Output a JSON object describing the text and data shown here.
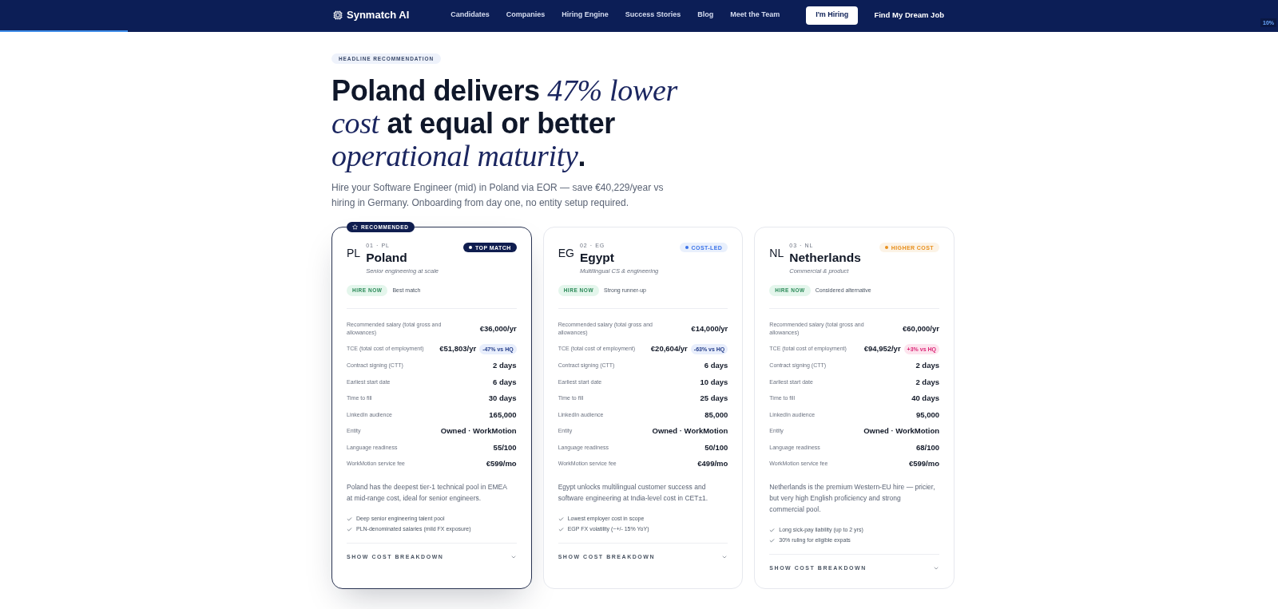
{
  "nav": {
    "brand": "Synmatch AI",
    "links": [
      "Candidates",
      "Companies",
      "Hiring Engine",
      "Success Stories",
      "Blog",
      "Meet the Team"
    ],
    "actions": [
      {
        "label": "I'm Hiring",
        "kind": "filled"
      },
      {
        "label": "Find My Dream Job",
        "kind": "plain"
      }
    ]
  },
  "scroll_progress": {
    "level": 0.1,
    "reading": "10%"
  },
  "hero": {
    "eyebrow": "HEADLINE RECOMMENDATION",
    "headline": "Poland delivers *47% lower cost* at equal or better *operational maturity*.",
    "subtitle": "Hire your Software Engineer (mid) in Poland via EOR — save €40,229/year vs hiring in Germany. Onboarding from day one, no entity setup required."
  },
  "cards": [
    {
      "recommended": true,
      "badge": "RECOMMENDED",
      "code": "PL",
      "index": "01 · PL",
      "name": "Poland",
      "tagline": "Senior engineering at scale",
      "tag": {
        "label": "TOP MATCH",
        "kind": "solid",
        "color": "#ffffff"
      },
      "status": "HIRE NOW",
      "note": "Best match",
      "rows": [
        {
          "label": "Recommended salary (total gross and allowances)",
          "value": "€36,000/yr"
        },
        {
          "label": "TCE (total cost of employment)",
          "value": "€51,803/yr",
          "delta": {
            "label": "-47% vs HQ",
            "kind": "lower"
          }
        },
        {
          "label": "Contract signing (CTT)",
          "value": "2 days"
        },
        {
          "label": "Earliest start date",
          "value": "6 days"
        },
        {
          "label": "Time to fill",
          "value": "30 days"
        },
        {
          "label": "LinkedIn audience",
          "value": "165,000"
        },
        {
          "label": "Entity",
          "value": "Owned · WorkMotion"
        },
        {
          "label": "Language readiness",
          "value": "55/100"
        },
        {
          "label": "WorkMotion service fee",
          "value": "€599/mo"
        }
      ],
      "description": "Poland has the deepest tier-1 technical pool in EMEA at mid-range cost, ideal for senior engineers.",
      "pros": [
        "Deep senior engineering talent pool",
        "PLN-denominated salaries (mild FX exposure)"
      ],
      "footer": {
        "label": "SHOW COST BREAKDOWN",
        "expanded": false
      }
    },
    {
      "recommended": false,
      "code": "EG",
      "index": "02 · EG",
      "name": "Egypt",
      "tagline": "Multilingual CS & engineering",
      "tag": {
        "label": "COST-LED",
        "kind": "soft",
        "color": "#3a72e8"
      },
      "status": "HIRE NOW",
      "note": "Strong runner-up",
      "rows": [
        {
          "label": "Recommended salary (total gross and allowances)",
          "value": "€14,000/yr"
        },
        {
          "label": "TCE (total cost of employment)",
          "value": "€20,604/yr",
          "delta": {
            "label": "-63% vs HQ",
            "kind": "lower"
          }
        },
        {
          "label": "Contract signing (CTT)",
          "value": "6 days"
        },
        {
          "label": "Earliest start date",
          "value": "10 days"
        },
        {
          "label": "Time to fill",
          "value": "25 days"
        },
        {
          "label": "LinkedIn audience",
          "value": "85,000"
        },
        {
          "label": "Entity",
          "value": "Owned · WorkMotion"
        },
        {
          "label": "Language readiness",
          "value": "50/100"
        },
        {
          "label": "WorkMotion service fee",
          "value": "€499/mo"
        }
      ],
      "description": "Egypt unlocks multilingual customer success and software engineering at India-level cost in CET±1.",
      "pros": [
        "Lowest employer cost in scope",
        "EGP FX volatility (~+/- 15% YoY)"
      ],
      "footer": {
        "label": "SHOW COST BREAKDOWN",
        "expanded": false
      }
    },
    {
      "recommended": false,
      "code": "NL",
      "index": "03 · NL",
      "name": "Netherlands",
      "tagline": "Commercial & product",
      "tag": {
        "label": "HIGHER COST",
        "kind": "soft",
        "color": "#e8901e"
      },
      "status": "HIRE NOW",
      "note": "Considered alternative",
      "rows": [
        {
          "label": "Recommended salary (total gross and allowances)",
          "value": "€60,000/yr"
        },
        {
          "label": "TCE (total cost of employment)",
          "value": "€94,952/yr",
          "delta": {
            "label": "+3% vs HQ",
            "kind": "higher"
          }
        },
        {
          "label": "Contract signing (CTT)",
          "value": "2 days"
        },
        {
          "label": "Earliest start date",
          "value": "2 days"
        },
        {
          "label": "Time to fill",
          "value": "40 days"
        },
        {
          "label": "LinkedIn audience",
          "value": "95,000"
        },
        {
          "label": "Entity",
          "value": "Owned · WorkMotion"
        },
        {
          "label": "Language readiness",
          "value": "68/100"
        },
        {
          "label": "WorkMotion service fee",
          "value": "€599/mo"
        }
      ],
      "description": "Netherlands is the premium Western-EU hire — pricier, but very high English proficiency and strong commercial pool.",
      "pros": [
        "Long sick-pay liability (up to 2 yrs)",
        "30% ruling for eligible expats"
      ],
      "footer": {
        "label": "SHOW COST BREAKDOWN",
        "expanded": false
      }
    }
  ]
}
